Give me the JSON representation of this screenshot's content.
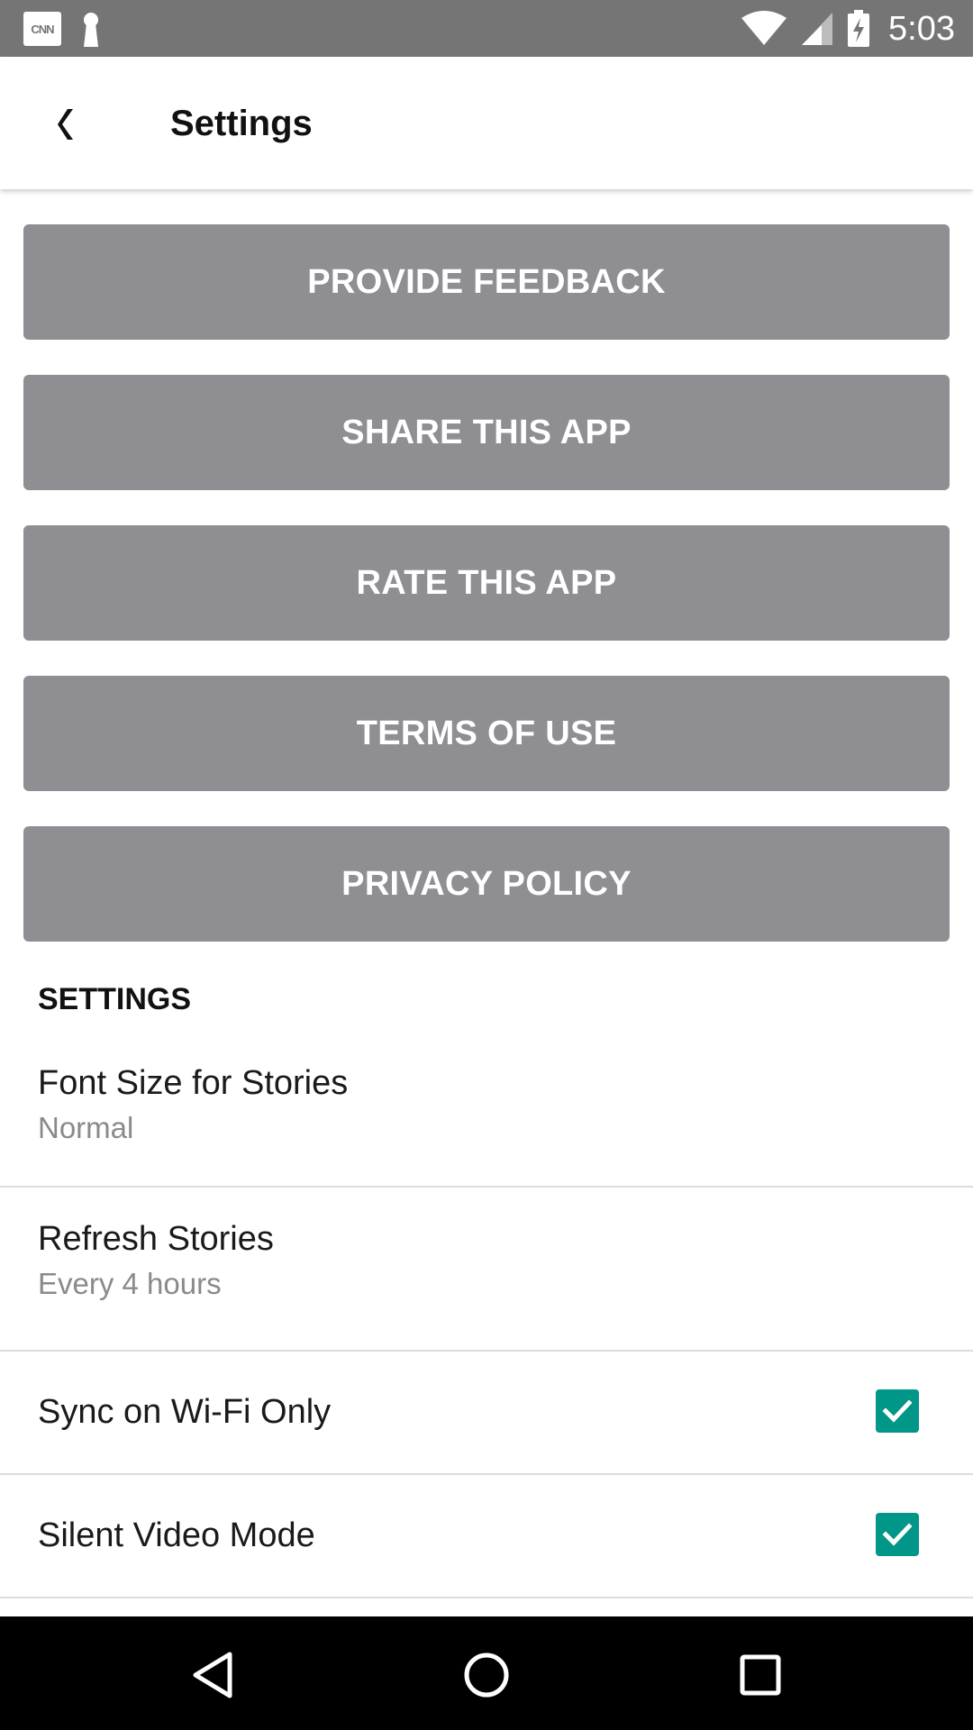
{
  "status_bar": {
    "time": "5:03",
    "cnn_label": "CNN",
    "icons": [
      "cnn-icon",
      "keyhole-icon",
      "wifi-icon",
      "cell-signal-icon",
      "battery-charging-icon"
    ]
  },
  "header": {
    "title": "Settings",
    "back_icon": "chevron-left-icon"
  },
  "actions": [
    {
      "label": "PROVIDE FEEDBACK"
    },
    {
      "label": "SHARE THIS APP"
    },
    {
      "label": "RATE THIS APP"
    },
    {
      "label": "TERMS OF USE"
    },
    {
      "label": "PRIVACY POLICY"
    }
  ],
  "settings": {
    "section_title": "SETTINGS",
    "items": [
      {
        "title": "Font Size for Stories",
        "value": "Normal"
      },
      {
        "title": "Refresh Stories",
        "value": "Every 4 hours"
      },
      {
        "title": "Sync on Wi-Fi Only",
        "checked": true
      },
      {
        "title": "Silent Video Mode",
        "checked": true
      }
    ]
  },
  "nav_bar": {
    "icons": [
      "back-triangle-icon",
      "home-circle-icon",
      "recents-square-icon"
    ]
  },
  "colors": {
    "status_bar": "#757575",
    "button_gray": "#8e8e93",
    "checkbox_teal": "#009688",
    "nav_bar": "#000000"
  }
}
